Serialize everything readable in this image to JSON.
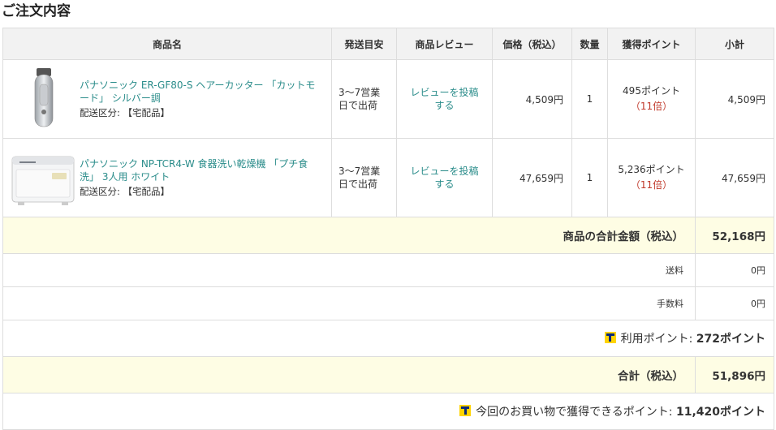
{
  "section_title": "ご注文内容",
  "headers": {
    "product": "商品名",
    "shipping": "発送目安",
    "review": "商品レビュー",
    "price": "価格（税込）",
    "qty": "数量",
    "points": "獲得ポイント",
    "subtotal": "小計"
  },
  "items": [
    {
      "name": "パナソニック ER-GF80-S ヘアーカッター 「カットモード」 シルバー調",
      "delivery": "配送区分: 【宅配品】",
      "shipping_line1": "3～7営業",
      "shipping_line2": "日で出荷",
      "review_line1": "レビューを投稿",
      "review_line2": "する",
      "price": "4,509円",
      "qty": "1",
      "points": "495ポイント",
      "multiplier": "（11倍）",
      "subtotal": "4,509円",
      "image": "hair-clipper"
    },
    {
      "name": "パナソニック NP-TCR4-W 食器洗い乾燥機 「プチ食洗」 3人用 ホワイト",
      "delivery": "配送区分: 【宅配品】",
      "shipping_line1": "3～7営業",
      "shipping_line2": "日で出荷",
      "review_line1": "レビューを投稿",
      "review_line2": "する",
      "price": "47,659円",
      "qty": "1",
      "points": "5,236ポイント",
      "multiplier": "（11倍）",
      "subtotal": "47,659円",
      "image": "dishwasher"
    }
  ],
  "summary": {
    "goods_total_label": "商品の合計金額（税込）",
    "goods_total_value": "52,168円",
    "shipping_label": "送料",
    "shipping_value": "0円",
    "fee_label": "手数料",
    "fee_value": "0円",
    "used_points_label": "利用ポイント: ",
    "used_points_value": "272ポイント",
    "grand_total_label": "合計（税込）",
    "grand_total_value": "51,896円",
    "earned_points_label": "今回のお買い物で獲得できるポイント: ",
    "earned_points_value": "11,420ポイント"
  },
  "colors": {
    "link": "#2a8c8a",
    "highlight_bg": "#fefde4",
    "multiplier": "#c0392b",
    "t_point_yellow": "#ffd400",
    "t_point_blue": "#0b2a7a"
  }
}
